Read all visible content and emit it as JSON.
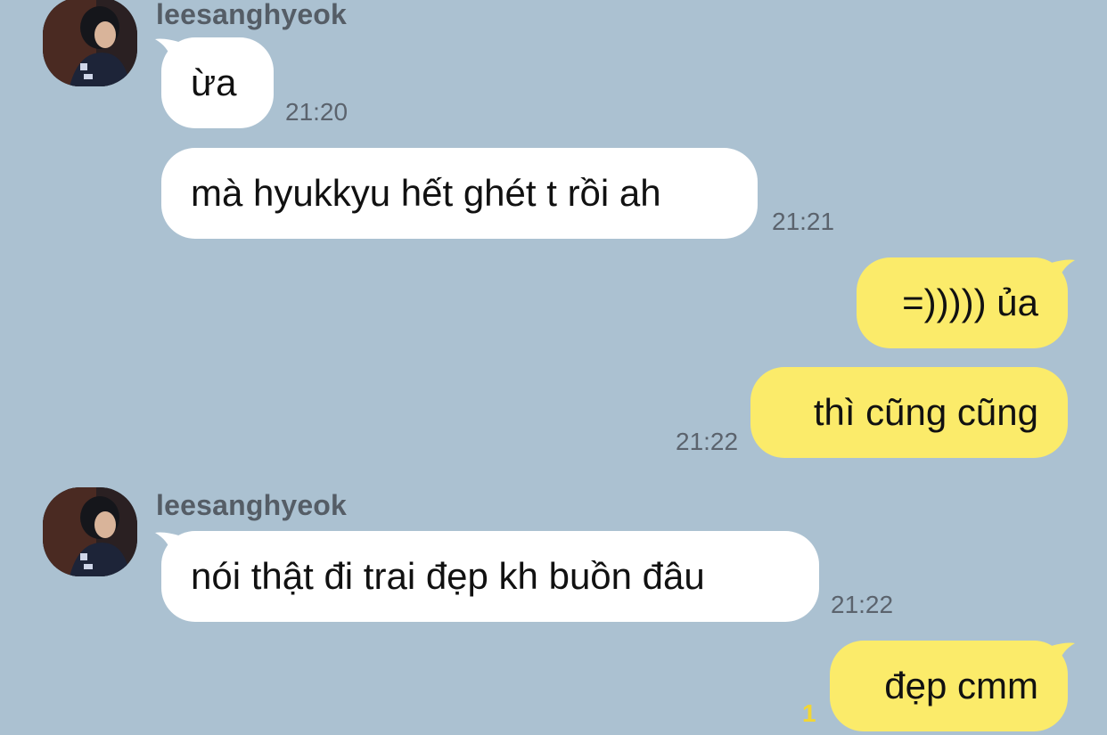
{
  "theme": {
    "background": "#abc1d1",
    "incoming_bubble": "#ffffff",
    "outgoing_bubble": "#fbeb6a",
    "unread_color": "#f2d635"
  },
  "messages": [
    {
      "direction": "incoming",
      "sender": "leesanghyeok",
      "text": "ừa",
      "time": "21:20"
    },
    {
      "direction": "incoming",
      "text": "mà hyukkyu hết ghét t rồi ah",
      "time": "21:21"
    },
    {
      "direction": "outgoing",
      "text": "=))))) ủa",
      "time": ""
    },
    {
      "direction": "outgoing",
      "text": "thì cũng cũng",
      "time": "21:22"
    },
    {
      "direction": "incoming",
      "sender": "leesanghyeok",
      "text": "nói thật đi trai đẹp kh buồn đâu",
      "time": "21:22"
    },
    {
      "direction": "outgoing",
      "text": "đẹp cmm",
      "unread_count": "1"
    }
  ],
  "icons": {
    "avatar": "profile-photo-avatar"
  }
}
